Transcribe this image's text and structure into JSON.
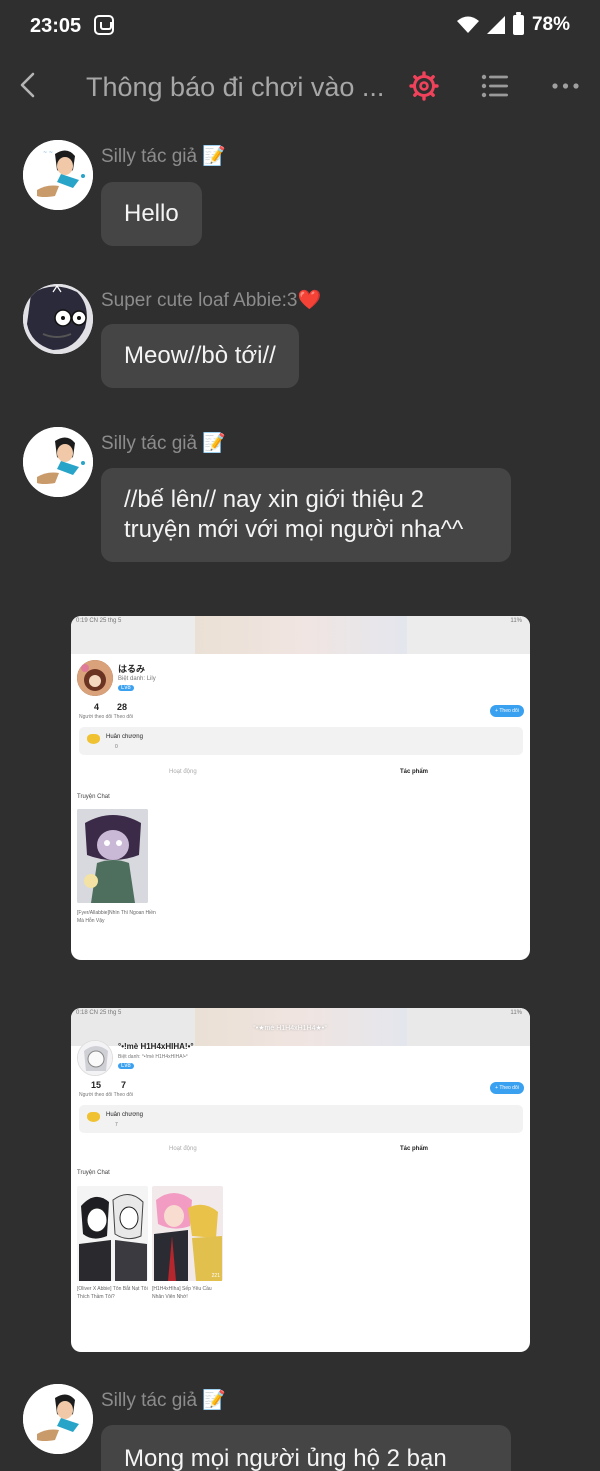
{
  "status_bar": {
    "time": "23:05",
    "battery": "78%"
  },
  "header": {
    "title": "Thông báo đi chơi vào ..."
  },
  "messages": [
    {
      "sender": "Silly tác giả 📝",
      "text": "Hello"
    },
    {
      "sender": "Super cute loaf Abbie:3❤️",
      "text": "Meow//bò tới//"
    },
    {
      "sender": "Silly tác giả 📝",
      "text": "//bế lên// nay xin giới thiệu 2 truyện mới với mọi người nha^^"
    },
    {
      "sender": "Silly tác giả 📝",
      "text": "Mong mọi người ủng hộ 2 bạn"
    }
  ],
  "shots": [
    {
      "status_time": "0:19  CN 25 thg 5",
      "battery": "11%",
      "profile_name": "はるみ",
      "nickname": "Biệt danh: Lily",
      "level": "Lv8",
      "followers": "4",
      "following": "28",
      "stats_label": "Người theo dõi Theo dõi",
      "follow_btn": "+ Theo dõi",
      "medal_label": "Huân chương",
      "medal_count": "0",
      "tab_activity": "Hoạt động",
      "tab_works": "Tác phẩm",
      "section": "Truyện Chat",
      "story_caption": "[Fyer/Allabbie]Nhìn Thì Ngoan Hiền Mà Hỗn Vậy"
    },
    {
      "status_time": "0:18  CN 25 thg 5",
      "battery": "11%",
      "banner_title": "°•★mè H1H4xH1H4★•°",
      "profile_name": "°•!mè H1H4xHIHA!•°",
      "nickname": "Biệt danh: °•!mè H1H4xHIHA!•°",
      "level": "Lv8",
      "followers": "15",
      "following": "7",
      "stats_label": "Người theo dõi Theo dõi",
      "follow_btn": "+ Theo dõi",
      "medal_label": "Huân chương",
      "medal_count": "7",
      "tab_activity": "Hoạt động",
      "tab_works": "Tác phẩm",
      "section": "Truyện Chat",
      "story1_caption": "[Oliver X Abbie] Tôn Bắt Nạt Tôi Thích Thầm Tôi?",
      "story2_caption": "[H1H4xHIha] Sếp Yêu Cầu Nhân Viên Nhớ!",
      "story2_likes": "221"
    }
  ]
}
